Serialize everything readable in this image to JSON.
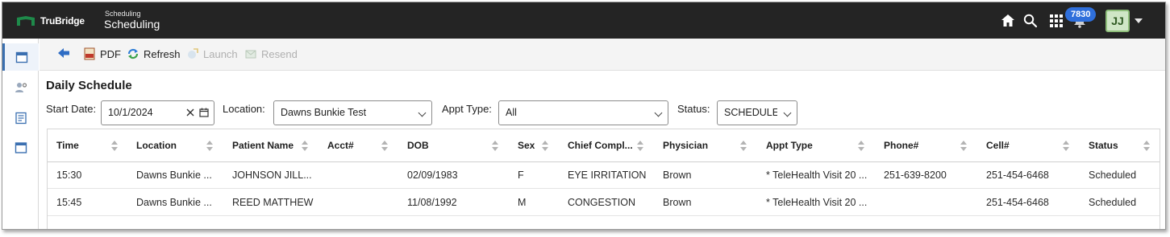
{
  "header": {
    "brand": "TruBridge",
    "app_sup": "Scheduling",
    "app_name": "Scheduling",
    "notification_count": "7830",
    "user_initials": "JJ"
  },
  "toolbar": {
    "pdf_label": "PDF",
    "refresh_label": "Refresh",
    "launch_label": "Launch",
    "resend_label": "Resend"
  },
  "page": {
    "title": "Daily Schedule"
  },
  "filters": {
    "start_date_label": "Start Date:",
    "start_date_value": "10/1/2024",
    "location_label": "Location:",
    "location_value": "Dawns Bunkie Test",
    "appt_type_label": "Appt Type:",
    "appt_type_value": "All",
    "status_label": "Status:",
    "status_value": "SCHEDULED"
  },
  "table": {
    "columns": [
      "Time",
      "Location",
      "Patient Name",
      "Acct#",
      "DOB",
      "Sex",
      "Chief Compl...",
      "Physician",
      "Appt Type",
      "Phone#",
      "Cell#",
      "Status"
    ],
    "rows": [
      [
        "15:30",
        "Dawns Bunkie ...",
        "JOHNSON JILL...",
        "",
        "02/09/1983",
        "F",
        "EYE IRRITATION",
        "Brown",
        "* TeleHealth Visit 20 ...",
        "251-639-8200",
        "251-454-6468",
        "Scheduled"
      ],
      [
        "15:45",
        "Dawns Bunkie ...",
        "REED MATTHEW",
        "",
        "11/08/1992",
        "M",
        "CONGESTION",
        "Brown",
        "* TeleHealth Visit 20 ...",
        "",
        "251-454-6468",
        "Scheduled"
      ]
    ]
  },
  "colors": {
    "header_bg": "#242424",
    "accent": "#2f6fdb",
    "brand_green": "#1e8a4a"
  }
}
